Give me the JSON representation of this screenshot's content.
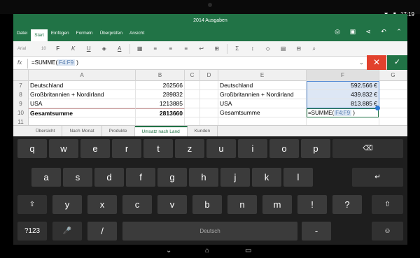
{
  "status": {
    "time": "17:19",
    "wifi_icon": "wifi-icon",
    "battery_icon": "battery-icon"
  },
  "app": {
    "title": "2014 Ausgaben"
  },
  "ribbon_tabs": [
    "Datei",
    "Start",
    "Einfügen",
    "Formeln",
    "Überprüfen",
    "Ansicht"
  ],
  "active_tab": "Start",
  "toolbar": {
    "font": "Arial",
    "size": "10"
  },
  "formula_bar": {
    "fx": "fx",
    "prefix": "=SUMME(",
    "ref": "F4:F9",
    "suffix": " )"
  },
  "columns": [
    "A",
    "B",
    "C",
    "D",
    "E",
    "F",
    "G"
  ],
  "rows": [
    {
      "n": "7",
      "a": "Deutschland",
      "b": "262566",
      "e": "Deutschland",
      "f": "592.566 €"
    },
    {
      "n": "8",
      "a": "Großbritannien + Nordirland",
      "b": "289832",
      "e": "Großbritannien + Nordirland",
      "f": "439.832 €"
    },
    {
      "n": "9",
      "a": "USA",
      "b": "1213885",
      "e": "USA",
      "f": "813.885 €"
    },
    {
      "n": "10",
      "a": "Gesamtsumme",
      "b": "2813660",
      "e": "Gesamtsumme",
      "f": ""
    },
    {
      "n": "11",
      "a": "",
      "b": "",
      "e": "",
      "f": ""
    }
  ],
  "edit_cell": {
    "prefix": "=SUMME(",
    "ref": "F4:F9",
    "suffix": " )"
  },
  "sheet_tabs": [
    "Übersicht",
    "Nach Monat",
    "Produkte",
    "Umsatz nach Land",
    "Kunden"
  ],
  "active_sheet": "Umsatz nach Land",
  "keyboard": {
    "row1": [
      "q",
      "w",
      "e",
      "r",
      "t",
      "z",
      "u",
      "i",
      "o",
      "p"
    ],
    "row2": [
      "a",
      "s",
      "d",
      "f",
      "g",
      "h",
      "j",
      "k",
      "l"
    ],
    "row3": [
      "y",
      "x",
      "c",
      "v",
      "b",
      "n",
      "m",
      "!",
      "?"
    ],
    "sym_label": "?123",
    "slash_label": "/",
    "space_label": "Deutsch",
    "dash_label": "-",
    "backspace_icon": "⌫",
    "enter_icon": "↵",
    "shift_icon": "⇧",
    "mic_icon": "🎤",
    "emoji_icon": "☺"
  },
  "colors": {
    "excel_green": "#217346",
    "cancel_red": "#e2412d",
    "selection_blue": "#2b78d6"
  }
}
